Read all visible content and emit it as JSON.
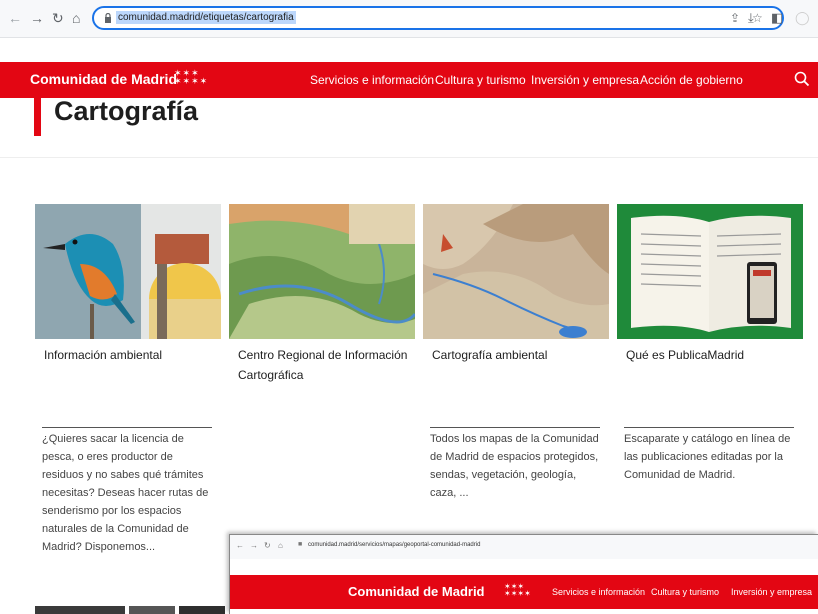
{
  "browser": {
    "url": "comunidad.madrid/etiquetas/cartografia"
  },
  "header": {
    "brand": "Comunidad de Madrid",
    "nav": [
      "Servicios e información",
      "Cultura y turismo",
      "Inversión y empresa",
      "Acción de gobierno"
    ]
  },
  "page": {
    "title": "Cartografía"
  },
  "cards": [
    {
      "title": "Información ambiental",
      "description": "¿Quieres sacar la licencia de pesca, o eres productor de residuos y no sabes qué trámites necesitas? Deseas hacer rutas de senderismo por los espacios naturales de la Comunidad de Madrid? Disponemos..."
    },
    {
      "title": "Centro Regional de Información Cartográfica",
      "description": ""
    },
    {
      "title": "Cartografía ambiental",
      "description": "Todos los mapas de la Comunidad de Madrid de espacios protegidos, sendas, vegetación, geología, caza, ..."
    },
    {
      "title": "Qué es PublicaMadrid",
      "description": "Escaparate y catálogo en línea de las publicaciones editadas por la Comunidad de Madrid."
    }
  ],
  "overlay": {
    "url": "comunidad.madrid/servicios/mapas/geoportal-comunidad-madrid",
    "brand": "Comunidad de Madrid",
    "nav": [
      "Servicios e información",
      "Cultura y turismo",
      "Inversión y empresa"
    ]
  },
  "colors": {
    "brand_red": "#e30613",
    "address_focus": "#1a73e8"
  }
}
